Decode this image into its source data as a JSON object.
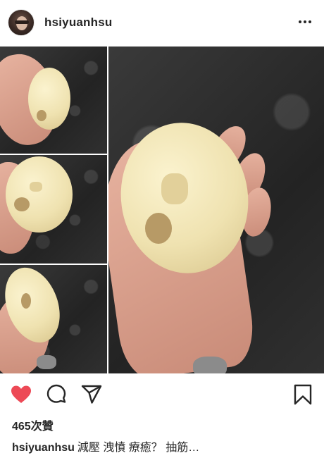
{
  "post": {
    "username": "hsiyuanhsu",
    "likes": "465次贊",
    "caption_user": "hsiyuanhsu",
    "caption_text": "減壓 洩憤 療癒？ 抽筋…"
  },
  "colors": {
    "heart": "#ed4956",
    "text": "#262626"
  },
  "icons": {
    "more": "more-options-icon",
    "like": "heart-icon",
    "comment": "comment-icon",
    "share": "share-icon",
    "save": "bookmark-icon"
  }
}
